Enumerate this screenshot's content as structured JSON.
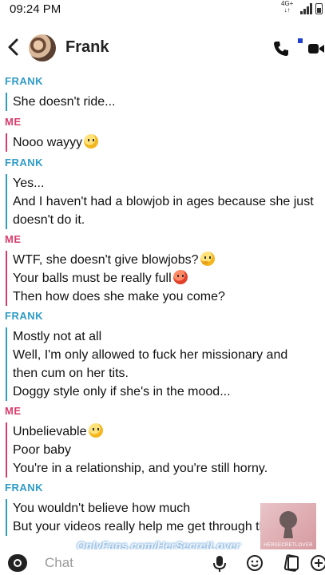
{
  "status_bar": {
    "time": "09:24 PM",
    "network": "4G+",
    "network_arrows": "↓↑"
  },
  "header": {
    "contact_name": "Frank",
    "icons": [
      "back-chevron-icon",
      "avatar",
      "phone-icon",
      "video-camera-icon"
    ]
  },
  "colors": {
    "frank": "#2f9cc7",
    "me": "#d63d6b"
  },
  "messages": [
    {
      "sender": "FRANK",
      "lines": [
        "She doesn't ride..."
      ]
    },
    {
      "sender": "ME",
      "lines": [
        "Nooo wayyy"
      ]
    },
    {
      "sender": "FRANK",
      "lines": [
        "Yes...",
        "And I haven't had a blowjob in ages because she just",
        "doesn't do it."
      ]
    },
    {
      "sender": "ME",
      "lines": [
        "WTF, she doesn't give blowjobs?",
        "Your balls must be really full",
        "Then how does she make you come?"
      ]
    },
    {
      "sender": "FRANK",
      "lines": [
        "Mostly not at all",
        "Well, I'm only allowed to fuck her missionary and",
        "then cum on her tits.",
        "Doggy style only if she's in the mood..."
      ]
    },
    {
      "sender": "ME",
      "lines": [
        "Unbelievable",
        "Poor baby",
        "You're in a relationship, and you're still horny."
      ]
    },
    {
      "sender": "FRANK",
      "lines": [
        "You wouldn't believe how much",
        "But your videos really help me get through the day"
      ]
    }
  ],
  "watermark": {
    "text": "OnlyFans.com/HerSecretLover",
    "tile_caption": "HERSECRETLOVER"
  },
  "input_bar": {
    "placeholder": "Chat"
  }
}
